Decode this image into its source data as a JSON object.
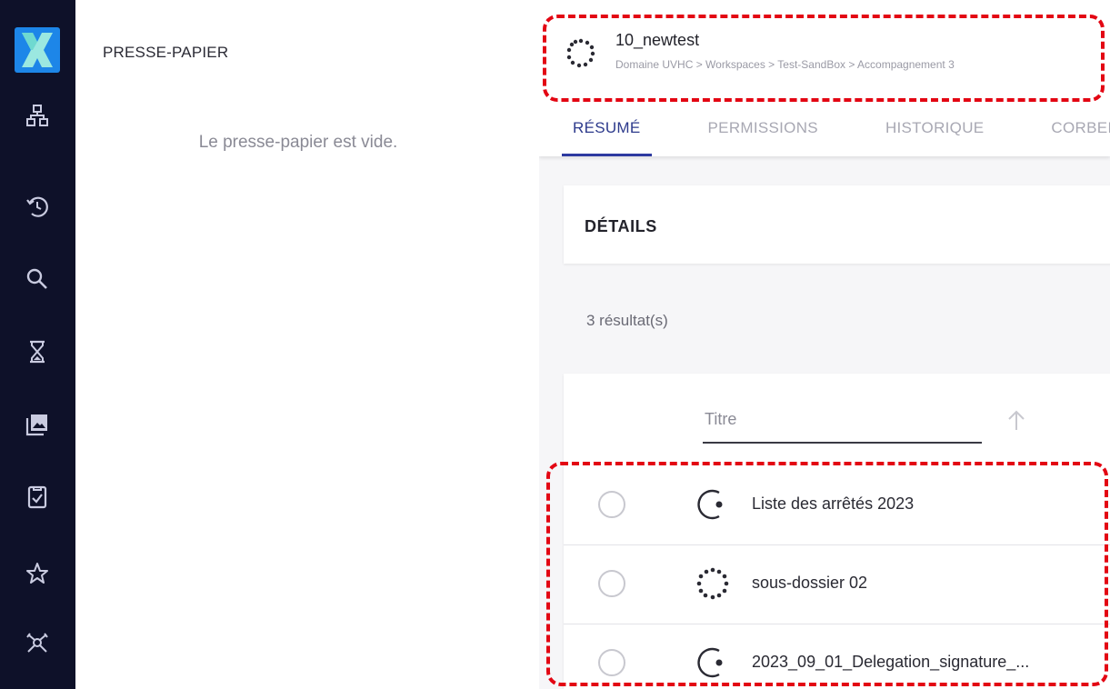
{
  "clipboard": {
    "title": "PRESSE-PAPIER",
    "empty_message": "Le presse-papier est vide."
  },
  "document": {
    "title": "10_newtest",
    "breadcrumb": "Domaine UVHC > Workspaces > Test-SandBox > Accompagnement 3"
  },
  "tabs": [
    {
      "label": "RÉSUMÉ",
      "active": true
    },
    {
      "label": "PERMISSIONS",
      "active": false
    },
    {
      "label": "HISTORIQUE",
      "active": false
    },
    {
      "label": "CORBEIL",
      "active": false
    }
  ],
  "details": {
    "label": "DÉTAILS"
  },
  "results": {
    "count_text": "3 résultat(s)"
  },
  "table": {
    "column_header": "Titre",
    "rows": [
      {
        "name": "Liste des arrêtés 2023",
        "icon": "folder-progress-icon"
      },
      {
        "name": "sous-dossier 02",
        "icon": "folder-dotted-icon"
      },
      {
        "name": "2023_09_01_Delegation_signature_...",
        "icon": "folder-progress-icon"
      }
    ]
  },
  "sidebar": {
    "items": [
      {
        "icon": "logo-x"
      },
      {
        "icon": "sitemap-icon"
      },
      {
        "icon": "history-icon"
      },
      {
        "icon": "search-icon"
      },
      {
        "icon": "hourglass-icon"
      },
      {
        "icon": "collections-icon"
      },
      {
        "icon": "task-checklist-icon"
      },
      {
        "icon": "star-icon"
      },
      {
        "icon": "workflow-icon"
      }
    ]
  },
  "colors": {
    "sidebar_bg": "#0e1129",
    "accent": "#2d3aa0",
    "highlight": "#e30613",
    "logo_bg": "#1d86e8"
  }
}
